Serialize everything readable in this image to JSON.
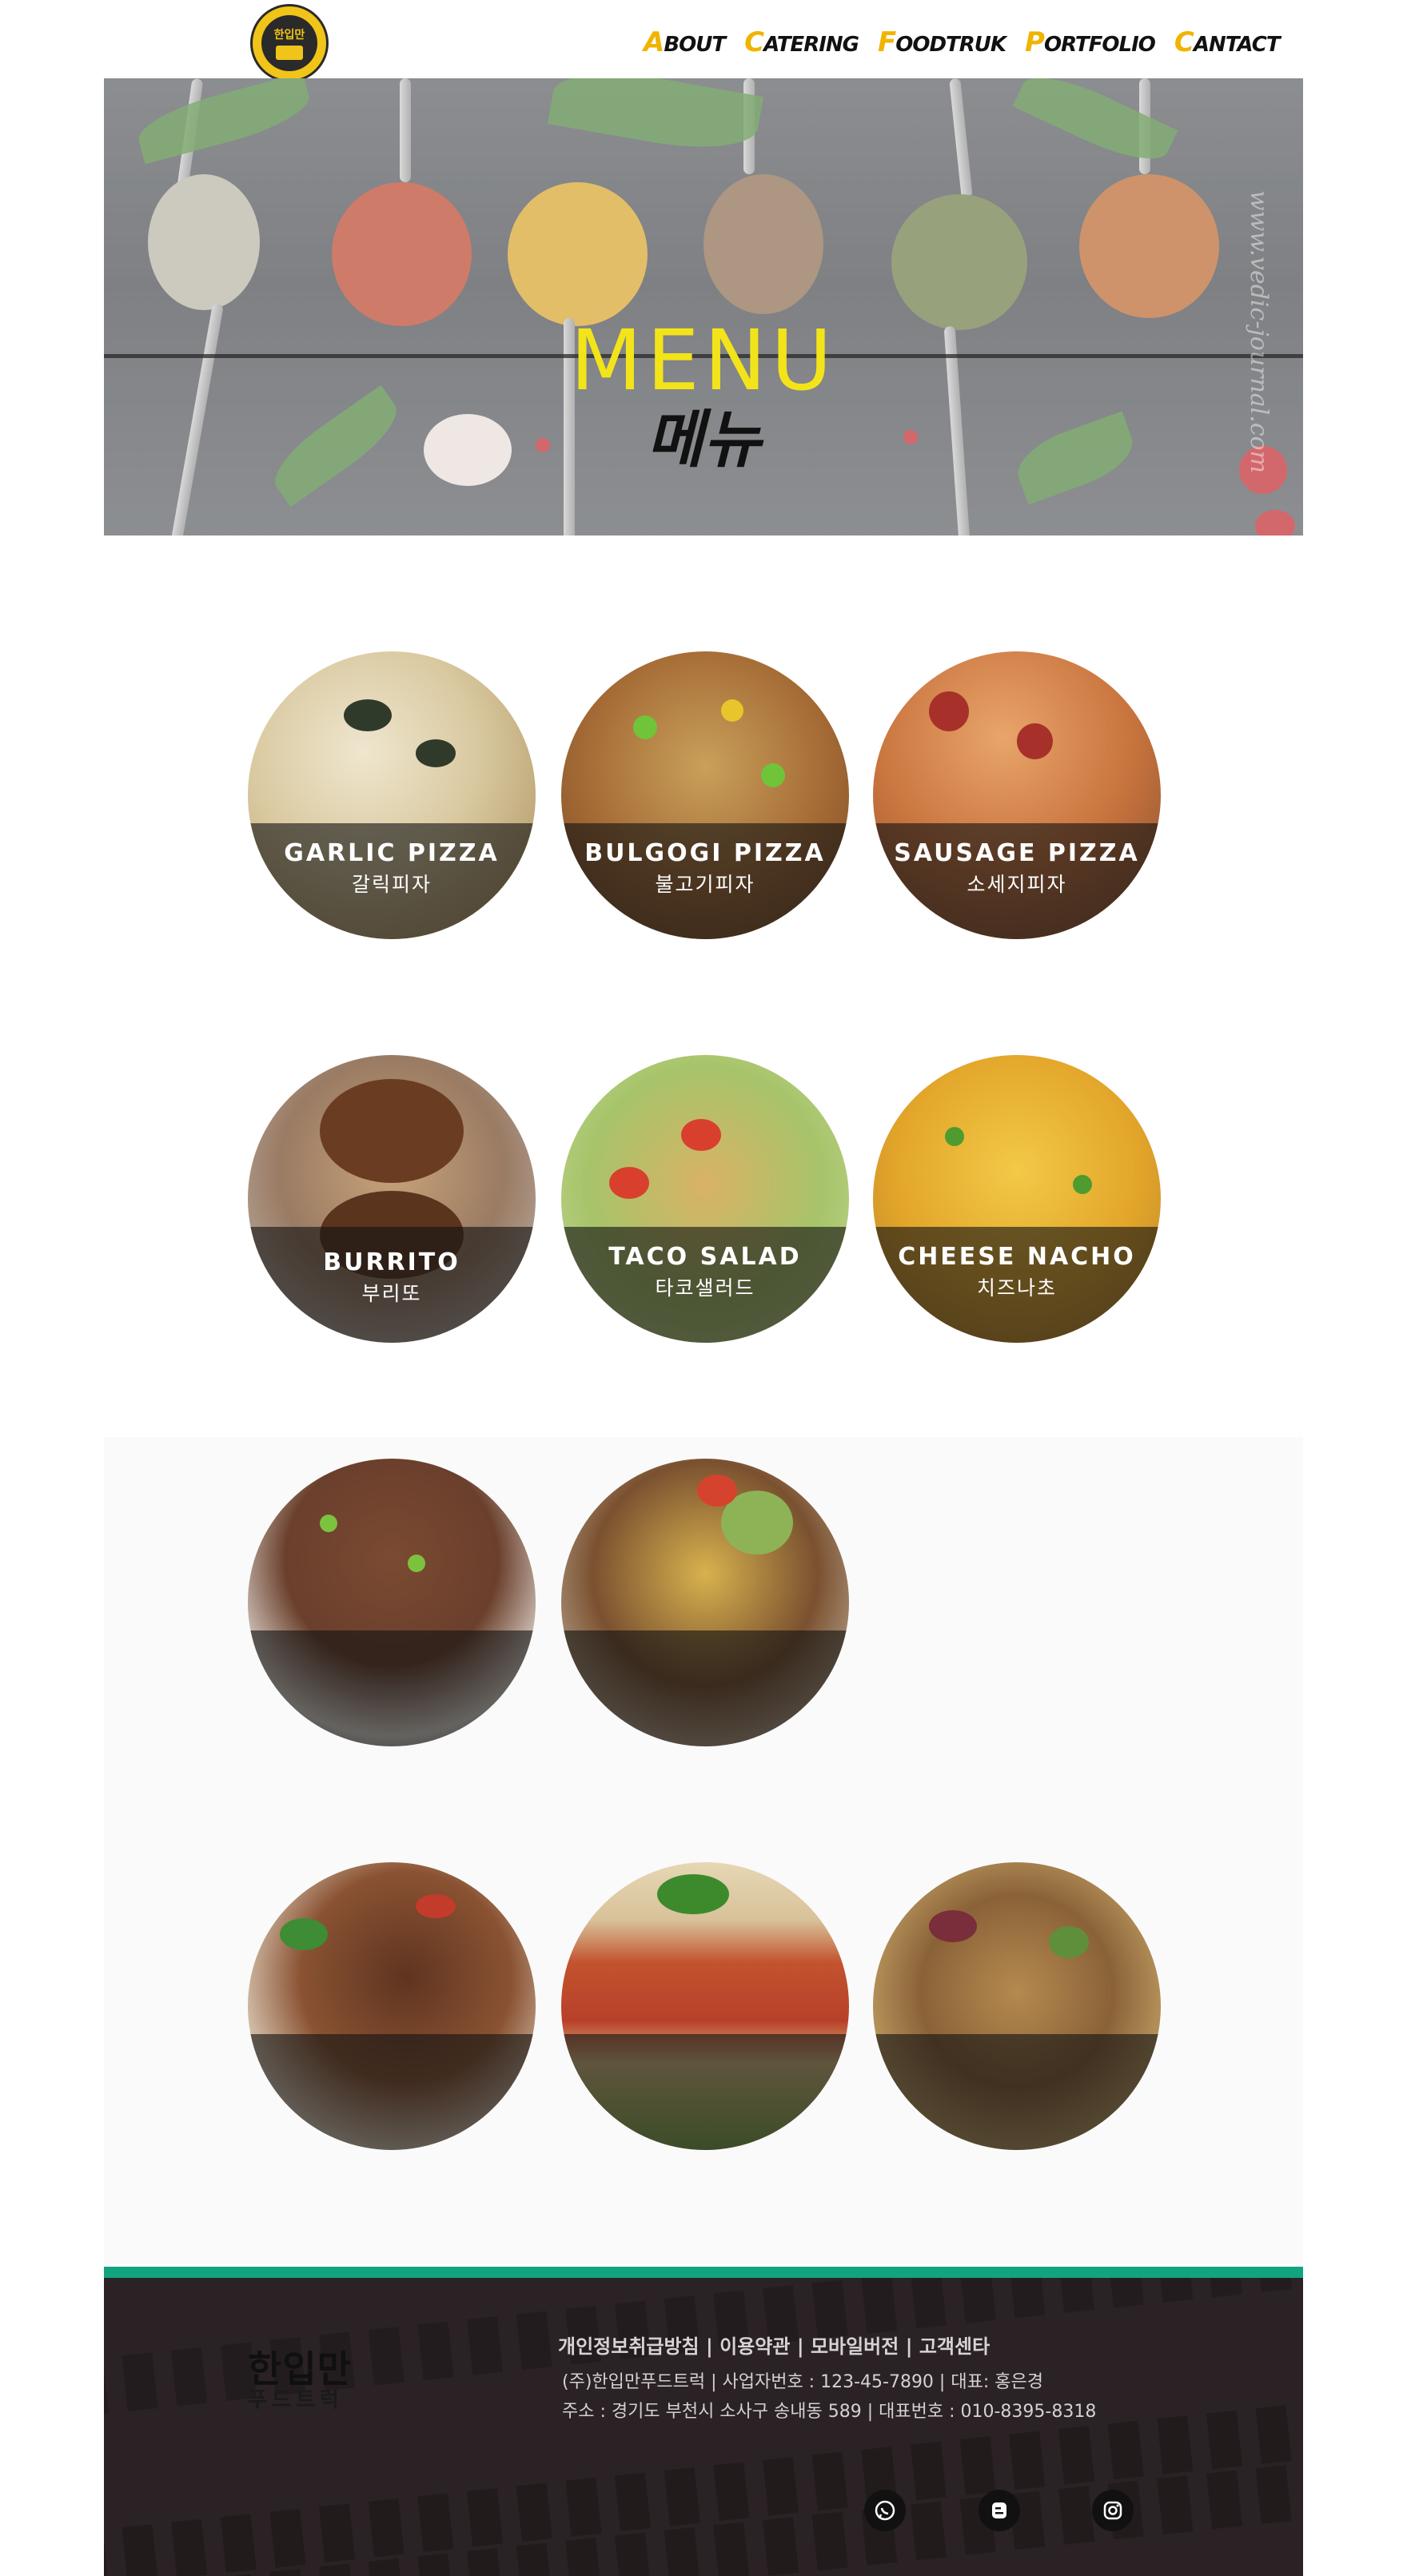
{
  "header": {
    "logo_text": "한입만",
    "nav": [
      {
        "first": "A",
        "rest": "BOUT"
      },
      {
        "first": "C",
        "rest": "ATERING"
      },
      {
        "first": "F",
        "rest": "OODTRUK"
      },
      {
        "first": "P",
        "rest": "ORTFOLIO"
      },
      {
        "first": "C",
        "rest": "ANTACT"
      }
    ]
  },
  "hero": {
    "title": "MENU",
    "subtitle": "메뉴",
    "watermark": "www.vedic-journal.com"
  },
  "menu": [
    {
      "en": "GARLIC PIZZA",
      "ko": "갈릭피자"
    },
    {
      "en": "BULGOGI PIZZA",
      "ko": "불고기피자"
    },
    {
      "en": "SAUSAGE PIZZA",
      "ko": "소세지피자"
    },
    {
      "en": "BURRITO",
      "ko": "부리또"
    },
    {
      "en": "TACO SALAD",
      "ko": "타코샐러드"
    },
    {
      "en": "CHEESE NACHO",
      "ko": "치즈나초"
    },
    {
      "en": "",
      "ko": ""
    },
    {
      "en": "",
      "ko": ""
    },
    {
      "en": "",
      "ko": ""
    },
    {
      "en": "",
      "ko": ""
    },
    {
      "en": "",
      "ko": ""
    }
  ],
  "footer": {
    "logo": "한입만",
    "logo_sub": "푸드트럭",
    "links": [
      "개인정보취급방침",
      "이용약관",
      "모바일버전",
      "고객센타"
    ],
    "info_line1": "(주)한입만푸드트럭  |  사업자번호 : 123-45-7890  |  대표: 홍은경",
    "info_line2": "주소 : 경기도 부천시 소사구 송내동 589 |  대표번호 : 010-8395-8318",
    "social": [
      "whatsapp-icon",
      "blogger-icon",
      "instagram-icon"
    ]
  },
  "colors": {
    "accent_yellow": "#f0b400",
    "menu_title_yellow": "#f3e419",
    "footer_bg": "#2a2224",
    "footer_accent": "#11a47f"
  }
}
